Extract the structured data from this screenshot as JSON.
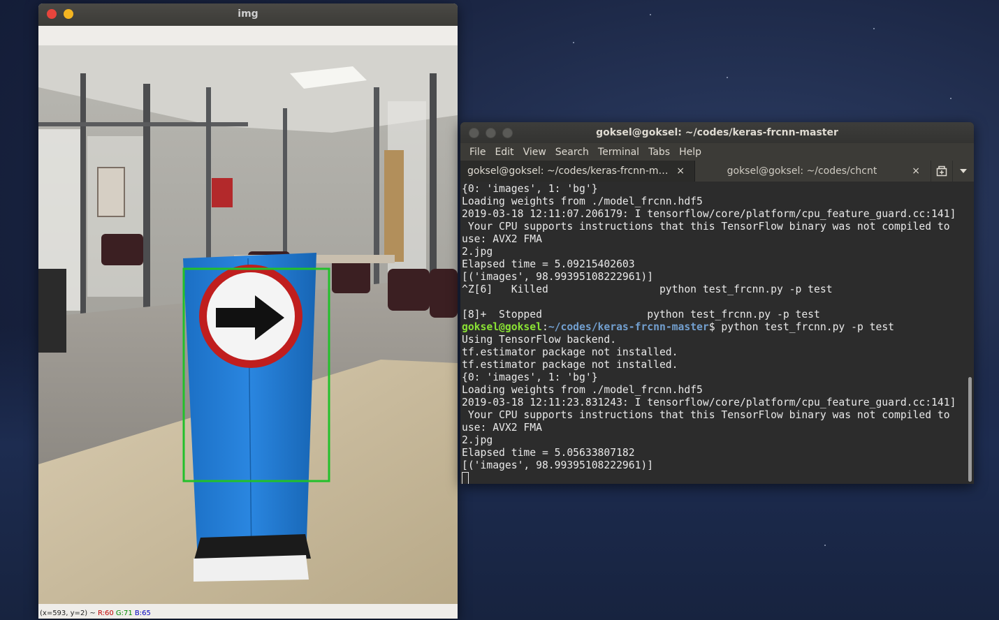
{
  "img_window": {
    "title": "img",
    "status": {
      "coords": "(x=593, y=2) ~ ",
      "r": "R:60",
      "g": "G:71",
      "b": "B:65"
    }
  },
  "terminal": {
    "title": "goksel@goksel: ~/codes/keras-frcnn-master",
    "menu": [
      "File",
      "Edit",
      "View",
      "Search",
      "Terminal",
      "Tabs",
      "Help"
    ],
    "tabs": [
      {
        "label": "goksel@goksel: ~/codes/keras-frcnn-mas...",
        "close": "×"
      },
      {
        "label": "goksel@goksel: ~/codes/chcnt",
        "close": "×"
      }
    ],
    "lines": [
      "{0: 'images', 1: 'bg'}",
      "Loading weights from ./model_frcnn.hdf5",
      "2019-03-18 12:11:07.206179: I tensorflow/core/platform/cpu_feature_guard.cc:141]",
      " Your CPU supports instructions that this TensorFlow binary was not compiled to",
      "use: AVX2 FMA",
      "2.jpg",
      "Elapsed time = 5.09215402603",
      "[('images', 98.99395108222961)]",
      "^Z[6]   Killed                  python test_frcnn.py -p test",
      "",
      "[8]+  Stopped                 python test_frcnn.py -p test"
    ],
    "prompt": {
      "user": "goksel@goksel",
      "path": "~/codes/keras-frcnn-master",
      "symbol": "$ ",
      "command": "python test_frcnn.py -p test"
    },
    "lines_after": [
      "Using TensorFlow backend.",
      "tf.estimator package not installed.",
      "tf.estimator package not installed.",
      "{0: 'images', 1: 'bg'}",
      "Loading weights from ./model_frcnn.hdf5",
      "2019-03-18 12:11:23.831243: I tensorflow/core/platform/cpu_feature_guard.cc:141]",
      " Your CPU supports instructions that this TensorFlow binary was not compiled to",
      "use: AVX2 FMA",
      "2.jpg",
      "Elapsed time = 5.05633807182",
      "[('images', 98.99395108222961)]"
    ]
  },
  "colors": {
    "detection_box": "#22c02a",
    "sign_panel": "#1f7fd8",
    "sign_ring": "#c01e1e"
  }
}
